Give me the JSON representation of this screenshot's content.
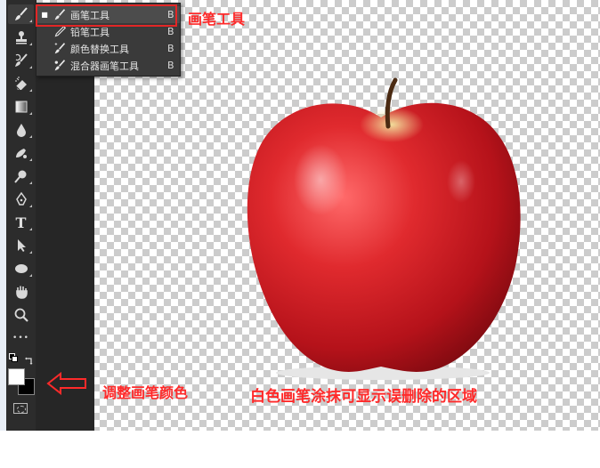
{
  "flyout": {
    "items": [
      {
        "label": "画笔工具",
        "shortcut": "B",
        "icon": "brush-icon",
        "selected": true
      },
      {
        "label": "铅笔工具",
        "shortcut": "B",
        "icon": "pencil-icon",
        "selected": false
      },
      {
        "label": "颜色替换工具",
        "shortcut": "B",
        "icon": "color-replace-icon",
        "selected": false
      },
      {
        "label": "混合器画笔工具",
        "shortcut": "B",
        "icon": "mixer-brush-icon",
        "selected": false
      }
    ]
  },
  "toolbar": {
    "tools": [
      {
        "name": "brush-tool",
        "icon": "brush-icon"
      },
      {
        "name": "clone-stamp-tool",
        "icon": "stamp-icon"
      },
      {
        "name": "history-brush-tool",
        "icon": "history-brush-icon"
      },
      {
        "name": "eraser-tool",
        "icon": "eraser-icon"
      },
      {
        "name": "gradient-tool",
        "icon": "gradient-icon"
      },
      {
        "name": "blur-tool",
        "icon": "drop-icon"
      },
      {
        "name": "sponge-tool",
        "icon": "sponge-icon"
      },
      {
        "name": "dodge-tool",
        "icon": "dodge-icon"
      },
      {
        "name": "pen-tool",
        "icon": "pen-icon"
      },
      {
        "name": "type-tool",
        "icon": "type-icon",
        "glyph": "T"
      },
      {
        "name": "path-selection-tool",
        "icon": "arrow-icon"
      },
      {
        "name": "ellipse-tool",
        "icon": "ellipse-icon"
      },
      {
        "name": "hand-tool",
        "icon": "hand-icon"
      },
      {
        "name": "zoom-tool",
        "icon": "zoom-icon"
      },
      {
        "name": "more-tools",
        "icon": "more-icon",
        "glyph": "•••"
      }
    ]
  },
  "colors": {
    "foreground": "#ffffff",
    "background": "#000000",
    "annotation": "#ff2a2a"
  },
  "annotations": {
    "brush_tool": "画笔工具",
    "adjust_color": "调整画笔颜色",
    "white_brush_note": "白色画笔涂抹可显示误删除的区域"
  }
}
